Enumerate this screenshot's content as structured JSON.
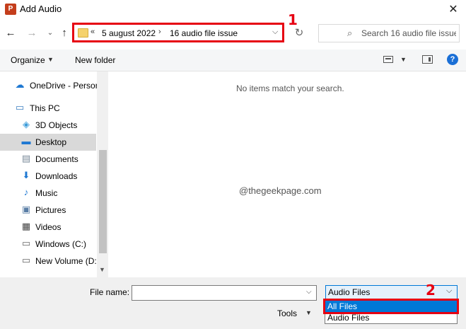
{
  "window": {
    "title": "Add Audio",
    "app_icon_letter": "P"
  },
  "address": {
    "more_glyph": "«",
    "breadcrumbs": [
      "5 august 2022",
      "16 audio file issue"
    ],
    "separator": "›"
  },
  "search": {
    "placeholder": "Search 16 audio file issue"
  },
  "toolbar": {
    "organize": "Organize",
    "new_folder": "New folder",
    "help": "?"
  },
  "sidebar": {
    "items": [
      {
        "label": "OneDrive - Person",
        "icon": "onedrive-icon"
      },
      {
        "label": "This PC",
        "icon": "pc-icon"
      },
      {
        "label": "3D Objects",
        "icon": "cube-icon"
      },
      {
        "label": "Desktop",
        "icon": "desktop-icon",
        "selected": true
      },
      {
        "label": "Documents",
        "icon": "documents-icon"
      },
      {
        "label": "Downloads",
        "icon": "downloads-icon"
      },
      {
        "label": "Music",
        "icon": "music-icon"
      },
      {
        "label": "Pictures",
        "icon": "pictures-icon"
      },
      {
        "label": "Videos",
        "icon": "videos-icon"
      },
      {
        "label": "Windows (C:)",
        "icon": "drive-icon"
      },
      {
        "label": "New Volume (D:",
        "icon": "drive-icon"
      }
    ]
  },
  "main": {
    "empty_message": "No items match your search.",
    "watermark": "@thegeekpage.com"
  },
  "bottom": {
    "filename_label": "File name:",
    "filename_value": "",
    "filetype_selected": "Audio Files",
    "filetype_options": [
      "All Files",
      "Audio Files"
    ],
    "highlighted_option": "All Files",
    "tools": "Tools"
  },
  "annotations": {
    "marker1": "1",
    "marker2": "2",
    "color": "#e60012"
  },
  "colors": {
    "accent": "#0078d7",
    "selection": "#d9d9d9",
    "help": "#1a6fd6"
  }
}
